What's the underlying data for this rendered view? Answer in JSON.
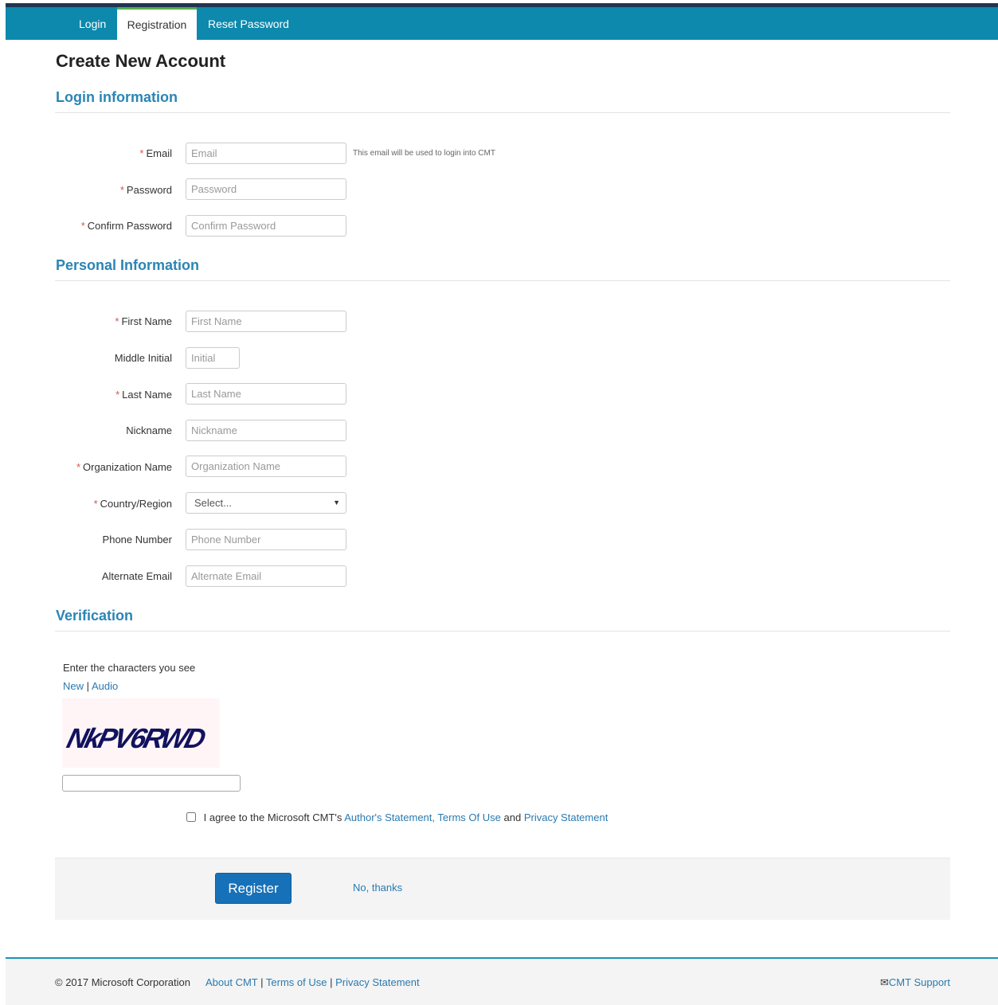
{
  "nav": {
    "tabs": [
      "Login",
      "Registration",
      "Reset Password"
    ]
  },
  "page": {
    "title": "Create New Account"
  },
  "sections": {
    "login": "Login information",
    "personal": "Personal Information",
    "verification": "Verification"
  },
  "required_mark": "*",
  "fields": {
    "email": {
      "label": "Email",
      "placeholder": "Email",
      "hint": "This email will be used to login into CMT"
    },
    "password": {
      "label": "Password",
      "placeholder": "Password"
    },
    "confirm_password": {
      "label": "Confirm Password",
      "placeholder": "Confirm Password"
    },
    "first_name": {
      "label": "First Name",
      "placeholder": "First Name"
    },
    "middle_initial": {
      "label": "Middle Initial",
      "placeholder": "Initial"
    },
    "last_name": {
      "label": "Last Name",
      "placeholder": "Last Name"
    },
    "nickname": {
      "label": "Nickname",
      "placeholder": "Nickname"
    },
    "organization": {
      "label": "Organization Name",
      "placeholder": "Organization Name"
    },
    "country": {
      "label": "Country/Region",
      "value": "Select..."
    },
    "phone": {
      "label": "Phone Number",
      "placeholder": "Phone Number"
    },
    "alternate_email": {
      "label": "Alternate Email",
      "placeholder": "Alternate Email"
    }
  },
  "captcha": {
    "prompt": "Enter the characters you see",
    "new_link": "New",
    "separator": "|",
    "audio_link": "Audio",
    "image_text": "NkPV6RWD"
  },
  "agree": {
    "prefix": "I agree to the Microsoft CMT's",
    "authors_statement": "Author's Statement,",
    "terms": "Terms Of Use",
    "and": "and",
    "privacy": "Privacy Statement"
  },
  "actions": {
    "register": "Register",
    "no_thanks": "No, thanks"
  },
  "footer": {
    "copyright": "© 2017 Microsoft Corporation",
    "about": "About CMT",
    "sep": "|",
    "terms": "Terms of Use",
    "privacy": "Privacy Statement",
    "support": "CMT Support"
  }
}
